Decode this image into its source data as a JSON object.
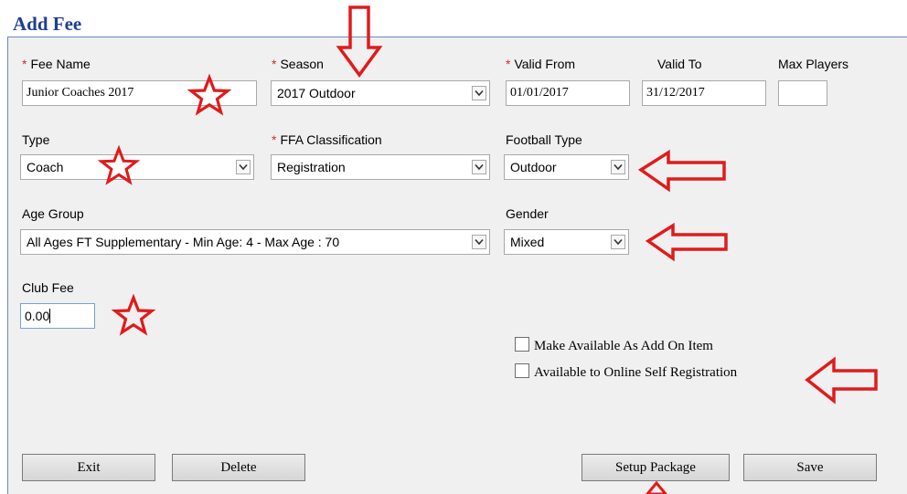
{
  "page": {
    "title": "Add Fee"
  },
  "required_marker": "*",
  "fields": {
    "fee_name": {
      "label": "Fee Name",
      "value": "Junior Coaches 2017"
    },
    "season": {
      "label": "Season",
      "value": "2017 Outdoor"
    },
    "valid_from": {
      "label": "Valid From",
      "value": "01/01/2017"
    },
    "valid_to": {
      "label": "Valid To",
      "value": "31/12/2017"
    },
    "max_players": {
      "label": "Max Players",
      "value": ""
    },
    "type": {
      "label": "Type",
      "value": "Coach"
    },
    "ffa_classification": {
      "label": "FFA Classification",
      "value": "Registration"
    },
    "football_type": {
      "label": "Football Type",
      "value": "Outdoor"
    },
    "age_group": {
      "label": "Age Group",
      "value": "All Ages FT Supplementary - Min Age: 4 - Max Age : 70"
    },
    "gender": {
      "label": "Gender",
      "value": "Mixed"
    },
    "club_fee": {
      "label": "Club Fee",
      "value": "0.00"
    }
  },
  "checkboxes": {
    "add_on": {
      "label": "Make Available As Add On Item",
      "checked": false
    },
    "online_self_registration": {
      "label": "Available to Online Self Registration",
      "checked": false
    }
  },
  "buttons": {
    "exit": "Exit",
    "delete": "Delete",
    "setup_package": "Setup Package",
    "save": "Save"
  },
  "colors": {
    "title": "#1f3f8f",
    "panel_background": "#f0f0f0",
    "panel_border": "#6b86c4",
    "required": "#d42a2a",
    "annotation": "#e01b1b"
  }
}
